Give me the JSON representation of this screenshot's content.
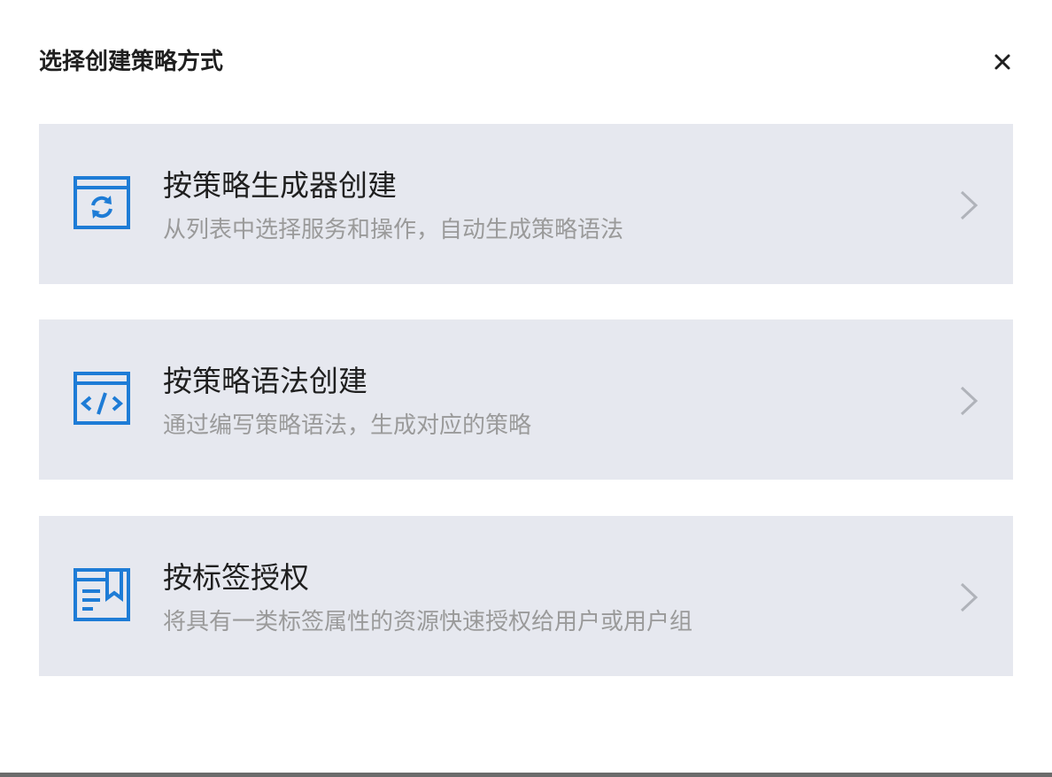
{
  "dialog": {
    "title": "选择创建策略方式",
    "close_icon": "close-icon"
  },
  "options": [
    {
      "icon": "policy-generator-icon",
      "title": "按策略生成器创建",
      "description": "从列表中选择服务和操作，自动生成策略语法"
    },
    {
      "icon": "policy-syntax-code-icon",
      "title": "按策略语法创建",
      "description": "通过编写策略语法，生成对应的策略"
    },
    {
      "icon": "tag-authorization-icon",
      "title": "按标签授权",
      "description": "将具有一类标签属性的资源快速授权给用户或用户组"
    }
  ],
  "colors": {
    "card_background": "#e6e8ef",
    "icon_blue": "#1e7cd6",
    "title_text": "#1f1f1f",
    "description_text": "#9a9a9a",
    "chevron": "#b0b3ba"
  }
}
